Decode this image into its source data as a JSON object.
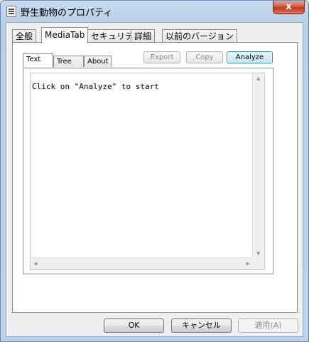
{
  "window": {
    "title": "野生動物のプロパティ",
    "close_label": "x"
  },
  "tabs": [
    {
      "label": "全般"
    },
    {
      "label": "MediaTab"
    },
    {
      "label": "セキュリティ"
    },
    {
      "label": "詳細"
    },
    {
      "label": "以前のバージョン"
    }
  ],
  "media": {
    "inner_tabs": [
      {
        "label": "Text"
      },
      {
        "label": "Tree"
      },
      {
        "label": "About"
      }
    ],
    "buttons": {
      "export": "Export",
      "copy": "Copy",
      "analyze": "Analyze"
    },
    "text_output": "Click on \"Analyze\" to start"
  },
  "scrollbars": {
    "up": "▲",
    "down": "▼",
    "left": "◀",
    "right": "▶"
  },
  "footer": {
    "ok": "OK",
    "cancel": "キャンセル",
    "apply": "適用(A)"
  }
}
